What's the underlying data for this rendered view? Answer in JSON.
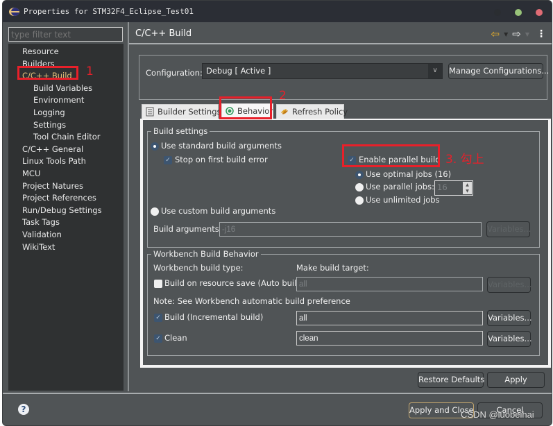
{
  "window": {
    "title": "Properties for STM32F4_Eclipse_Test01"
  },
  "left": {
    "filter_placeholder": "type filter text",
    "tree": [
      {
        "label": "Resource",
        "level": 1
      },
      {
        "label": "Builders",
        "level": 1
      },
      {
        "label": "C/C++ Build",
        "level": 1,
        "selected": true
      },
      {
        "label": "Build Variables",
        "level": 2
      },
      {
        "label": "Environment",
        "level": 2
      },
      {
        "label": "Logging",
        "level": 2
      },
      {
        "label": "Settings",
        "level": 2
      },
      {
        "label": "Tool Chain Editor",
        "level": 2
      },
      {
        "label": "C/C++ General",
        "level": 1
      },
      {
        "label": "Linux Tools Path",
        "level": 1
      },
      {
        "label": "MCU",
        "level": 1
      },
      {
        "label": "Project Natures",
        "level": 1
      },
      {
        "label": "Project References",
        "level": 1
      },
      {
        "label": "Run/Debug Settings",
        "level": 1
      },
      {
        "label": "Task Tags",
        "level": 1
      },
      {
        "label": "Validation",
        "level": 1
      },
      {
        "label": "WikiText",
        "level": 1
      }
    ]
  },
  "right": {
    "heading": "C/C++ Build",
    "nav_icons": [
      "back-arrow-icon",
      "forward-arrow-icon",
      "more-vertical-icon"
    ],
    "configuration": {
      "label": "Configuration:",
      "value": "Debug  [ Active ]",
      "manage_button": "Manage Configurations..."
    },
    "tabs": [
      {
        "label": "Builder Settings",
        "icon": "document-icon",
        "active": false
      },
      {
        "label": "Behavior",
        "icon": "radio-target-icon",
        "active": true
      },
      {
        "label": "Refresh Policy",
        "icon": "refresh-arrows-icon",
        "active": false
      }
    ],
    "build_settings": {
      "legend": "Build settings",
      "use_standard": {
        "label": "Use standard build arguments",
        "selected": true
      },
      "stop_on_error": {
        "label": "Stop on first build error",
        "checked": true
      },
      "enable_parallel": {
        "label": "Enable parallel build",
        "checked": true
      },
      "optimal_jobs": {
        "label": "Use optimal jobs (16)",
        "selected": true
      },
      "parallel_jobs": {
        "label": "Use parallel jobs:",
        "selected": false,
        "value": "16"
      },
      "unlimited_jobs": {
        "label": "Use unlimited jobs",
        "selected": false
      },
      "use_custom": {
        "label": "Use custom build arguments",
        "selected": false
      },
      "build_arguments_label": "Build arguments:",
      "build_arguments_value": "-j16",
      "variables_button": "Variables..."
    },
    "workbench": {
      "legend": "Workbench Build Behavior",
      "build_type_label": "Workbench build type:",
      "make_target_label": "Make build target:",
      "auto_build": {
        "label": "Build on resource save (Auto build)",
        "checked": false,
        "target": "all"
      },
      "note": "Note: See Workbench automatic build preference",
      "incremental": {
        "label": "Build (Incremental build)",
        "checked": true,
        "target": "all"
      },
      "clean": {
        "label": "Clean",
        "checked": true,
        "target": "clean"
      },
      "variables_button": "Variables..."
    },
    "restore_defaults": "Restore Defaults",
    "apply": "Apply"
  },
  "footer": {
    "apply_close": "Apply and Close",
    "cancel": "Cancel"
  },
  "annotations": {
    "step1": "1",
    "step2": "2",
    "step3": "3. 勾上",
    "color": "#e8202a"
  },
  "watermark": "CSDN @luobeihai"
}
